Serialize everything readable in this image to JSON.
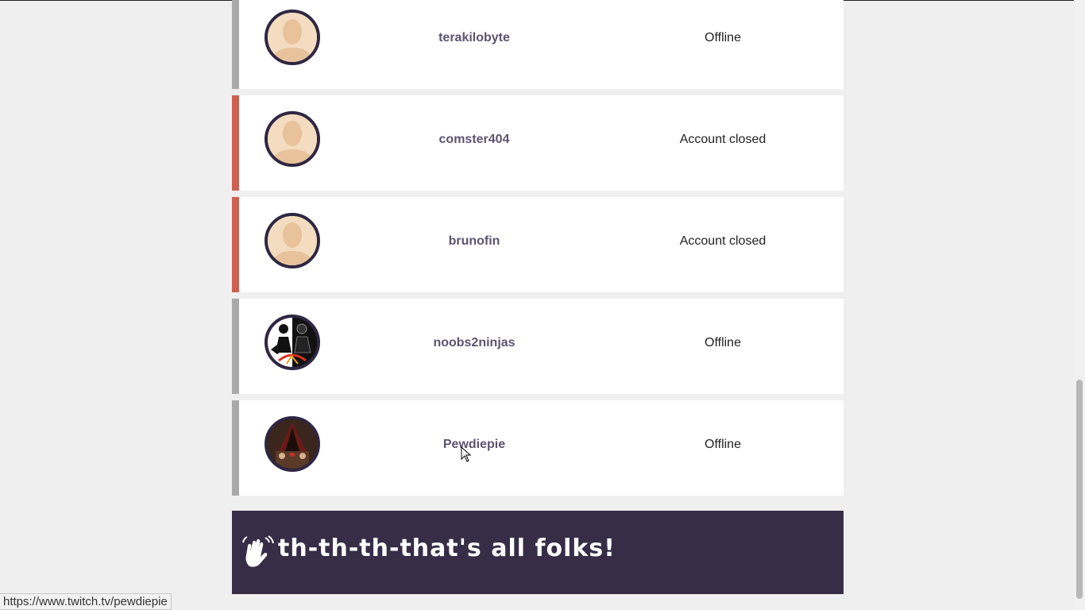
{
  "streamers": [
    {
      "name": "terakilobyte",
      "status": "Offline",
      "avatar": "default-avatar",
      "state": "offline"
    },
    {
      "name": "comster404",
      "status": "Account closed",
      "avatar": "default-avatar",
      "state": "closed"
    },
    {
      "name": "brunofin",
      "status": "Account closed",
      "avatar": "default-avatar",
      "state": "closed"
    },
    {
      "name": "noobs2ninjas",
      "status": "Offline",
      "avatar": "noobs2ninjas-logo",
      "state": "offline"
    },
    {
      "name": "Pewdiepie",
      "status": "Offline",
      "avatar": "pewdiepie-photo",
      "state": "offline"
    }
  ],
  "footer": {
    "icon": "waving-hands-icon",
    "message": "th-th-th-that's all folks!"
  },
  "statusbar": {
    "url": "https://www.twitch.tv/pewdiepie"
  },
  "colors": {
    "closed_accent": "#cc6152",
    "offline_accent": "#a9a9a9",
    "footer_bg": "#372d46",
    "name_text": "#5b5470"
  }
}
